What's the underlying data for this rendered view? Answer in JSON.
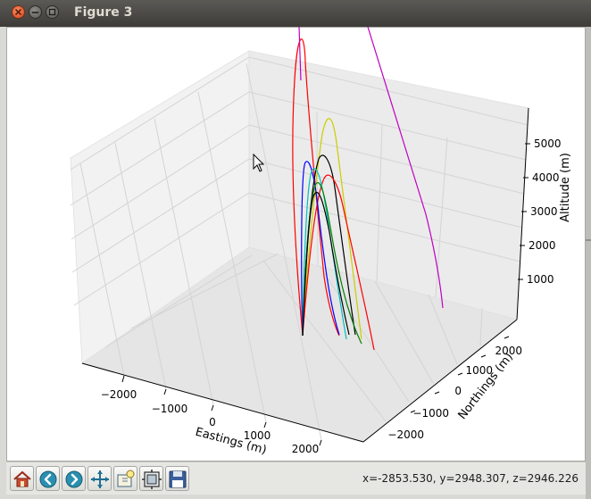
{
  "window": {
    "title": "Figure 3"
  },
  "toolbar": {
    "buttons": [
      {
        "name": "home-button",
        "icon": "home-icon"
      },
      {
        "name": "back-button",
        "icon": "arrow-left-icon"
      },
      {
        "name": "forward-button",
        "icon": "arrow-right-icon"
      },
      {
        "name": "pan-button",
        "icon": "move-icon"
      },
      {
        "name": "zoom-button",
        "icon": "zoom-rect-icon"
      },
      {
        "name": "subplots-button",
        "icon": "subplots-icon"
      },
      {
        "name": "save-button",
        "icon": "floppy-disk-icon"
      }
    ],
    "coords": "x=-2853.530, y=2948.307, z=2946.226"
  },
  "chart_data": {
    "type": "line3d",
    "title": "",
    "xlabel": "Eastings (m)",
    "ylabel": "Northings (m)",
    "zlabel": "Altitude (m)",
    "xticks": [
      "−2000",
      "−1000",
      "0",
      "1000",
      "2000"
    ],
    "yticks": [
      "−2000",
      "−1000",
      "0",
      "1000",
      "2000"
    ],
    "zticks": [
      "1000",
      "2000",
      "3000",
      "4000",
      "5000"
    ],
    "grid": true,
    "series": [
      {
        "color": "#ff0000",
        "description": "tallest arc, leaves plot top",
        "peak_altitude_m": 6000
      },
      {
        "color": "#cccc00",
        "peak_altitude_m": 5600
      },
      {
        "color": "#000000",
        "peak_altitude_m": 5000
      },
      {
        "color": "#ff0000",
        "peak_altitude_m": 4800
      },
      {
        "color": "#0000ff",
        "peak_altitude_m": 4900
      },
      {
        "color": "#00bfbf",
        "peak_altitude_m": 4600
      },
      {
        "color": "#008000",
        "peak_altitude_m": 4300
      },
      {
        "color": "#bf00bf",
        "description": "nearly straight descending line",
        "peak_altitude_m": 6000
      }
    ]
  }
}
